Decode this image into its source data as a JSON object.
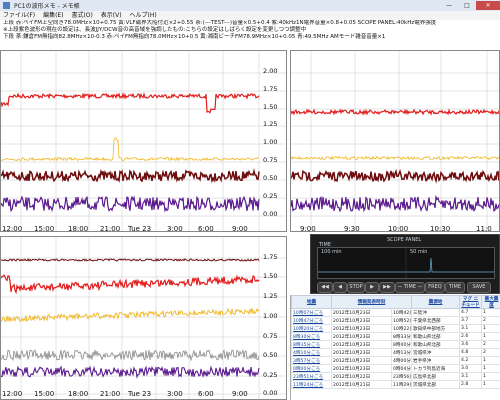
{
  "window": {
    "title": "PC1の波形メモ - メモ帳",
    "minimize": "—",
    "maximize": "□",
    "close": "✕"
  },
  "menu": [
    "ファイル(F)",
    "編集(E)",
    "書式(O)",
    "表示(V)",
    "ヘルプ(H)"
  ],
  "memo_lines": [
    "上段  赤:ペイFM上空向き78.0MHz×10+0.75   黄:VLF磁界大船付近×2+0.55   茶:(---TEST---)音量×0.5+0.4   紫:40kHz1N電界音量×0.8+0.05   SCOPE PANEL:40kHz電界強度",
    "※上段紫色波形の現在の設定は、長波JJY/DCW音の高音域を強調したもの:こちらの設定はしばらく設定を変更しつつ調整中",
    "下段  茶:鎌倉FM無指向82.8MHz×10-0.3   赤:ペイFM無指向78.0MHz×10+0.5   黄:湘南ビーチFM78.9MHz×10+0.05   青:49.5MHz AMモード雑音音量×1"
  ],
  "chart_top_left": {
    "x_ticks": [
      "12:00",
      "15:00",
      "18:00",
      "21:00",
      "Tue 23",
      "3:00",
      "6:00",
      "9:00"
    ]
  },
  "chart_top_right": {
    "x_ticks": [
      "9:00",
      "9:30",
      "10:00",
      "10:30",
      "11:0"
    ]
  },
  "y_axis_upper": [
    "2.00",
    "1.75",
    "1.50",
    "1.25",
    "1.00",
    "0.75",
    "0.50",
    "0.25",
    "0.00"
  ],
  "y_axis_lower": [
    "1.75",
    "1.50",
    "1.25",
    "1.00",
    "0.75",
    "0.50",
    "0.25",
    "0.00"
  ],
  "chart_bottom_left": {
    "x_ticks": [
      "12:00",
      "15:00",
      "18:00",
      "21:00",
      "Tue 23",
      "3:00",
      "6:00",
      "9:00"
    ]
  },
  "colors": {
    "red": "#e11d1d",
    "yellow": "#f0b51c",
    "maroon": "#6e0d0d",
    "purple": "#5a1a8e",
    "gray": "#888888"
  },
  "scope": {
    "title": "SCOPE PANEL",
    "time_label": "TIME",
    "left_time": "100 min",
    "right_time": "50 min",
    "buttons": [
      "◀◀",
      "◀",
      "STOP",
      "▶",
      "▶▶",
      "— TIME —",
      "FREQ",
      "TIME",
      "SAVE"
    ]
  },
  "table": {
    "headers": [
      "地震",
      "情報発表時刻",
      "震源地",
      "マグ\nニチュード",
      "最大震度"
    ],
    "rows": [
      [
        "10時07分ごろ",
        "2012年10月23日",
        "10時42分",
        "三陸沖",
        "4.7",
        "1"
      ],
      [
        "10時47分ごろ",
        "2012年10月23日",
        "10時52分",
        "千葉県北西部",
        "3.7",
        "2"
      ],
      [
        "10時20分ごろ",
        "2012年10月23日",
        "10時22分",
        "歌知県中部地方",
        "3.1",
        "1"
      ],
      [
        "8時30分ごろ",
        "2012年10月23日",
        "8時33分",
        "和歌山県北部",
        "2.6",
        "1"
      ],
      [
        "8時35分ごろ",
        "2012年10月23日",
        "8時40分",
        "和歌山県北部",
        "3.6",
        "2"
      ],
      [
        "4時10分ごろ",
        "2012年10月23日",
        "4時13分",
        "宮城県沖",
        "4.8",
        "2"
      ],
      [
        "3時57分ごろ",
        "2012年10月23日",
        "4時00分",
        "岩手県沖",
        "4.2",
        "1"
      ],
      [
        "0時00分ごろ",
        "2012年10月23日",
        "0時04分",
        "トカラ列島近海",
        "3.0",
        "1"
      ],
      [
        "23時51分ごろ",
        "2012年10月22日",
        "23時56分",
        "広島県北部",
        "3.1",
        "1"
      ],
      [
        "11時24分ごろ",
        "2012年10月21日",
        "11時29分",
        "茨城県北部",
        "2.8",
        "1"
      ]
    ]
  }
}
